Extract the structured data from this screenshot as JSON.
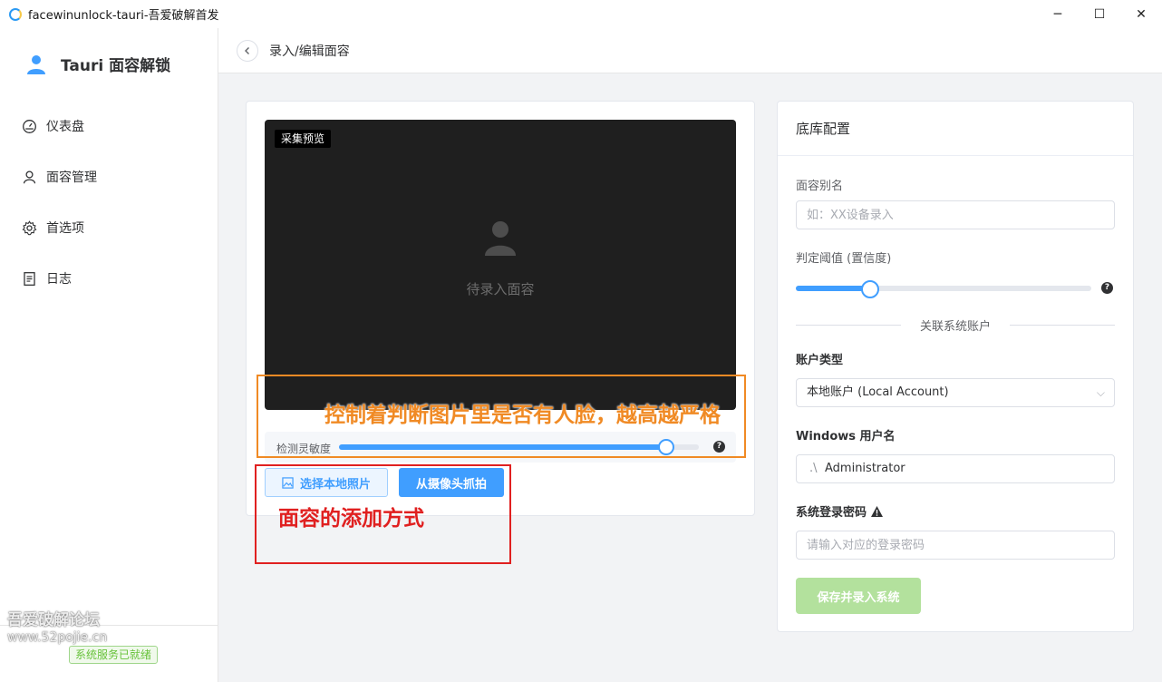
{
  "window": {
    "title": "facewinunlock-tauri-吾爱破解首发",
    "minimize": "─",
    "maximize": "☐",
    "close": "✕"
  },
  "sidebar": {
    "brand": "Tauri 面容解锁",
    "items": [
      {
        "label": "仪表盘",
        "icon": "dashboard-icon"
      },
      {
        "label": "面容管理",
        "icon": "user-icon"
      },
      {
        "label": "首选项",
        "icon": "gear-icon"
      },
      {
        "label": "日志",
        "icon": "document-icon"
      }
    ],
    "status": "系统服务已就绪"
  },
  "watermark": {
    "line1": "吾爱破解论坛",
    "line2": "www.52pojie.cn"
  },
  "header": {
    "back_icon": "chevron-left-icon",
    "title": "录入/编辑面容"
  },
  "capture": {
    "preview_tag": "采集预览",
    "placeholder": "待录入面容",
    "sensitivity_label": "检测灵敏度",
    "sensitivity_value": 0.91,
    "help": "?",
    "btn_local": "选择本地照片",
    "btn_camera": "从摄像头抓拍"
  },
  "config": {
    "title": "底库配置",
    "alias_label": "面容别名",
    "alias_placeholder": "如：XX设备录入",
    "threshold_label": "判定阈值 (置信度)",
    "threshold_value": 0.25,
    "help": "?",
    "divider": "关联系统账户",
    "account_type_label": "账户类型",
    "account_type_value": "本地账户 (Local Account)",
    "chevron": "⌵",
    "username_label": "Windows 用户名",
    "username_prefix": ".\\",
    "username_value": "Administrator",
    "password_label": "系统登录密码",
    "password_placeholder": "请输入对应的登录密码",
    "save": "保存并录入系统"
  },
  "annotations": {
    "orange": "控制着判断图片里是否有人脸，越高越严格",
    "red": "面容的添加方式"
  },
  "colors": {
    "accent": "#409eff",
    "success": "#67c23a",
    "annotation_orange": "#f08a24",
    "annotation_red": "#e02020"
  }
}
